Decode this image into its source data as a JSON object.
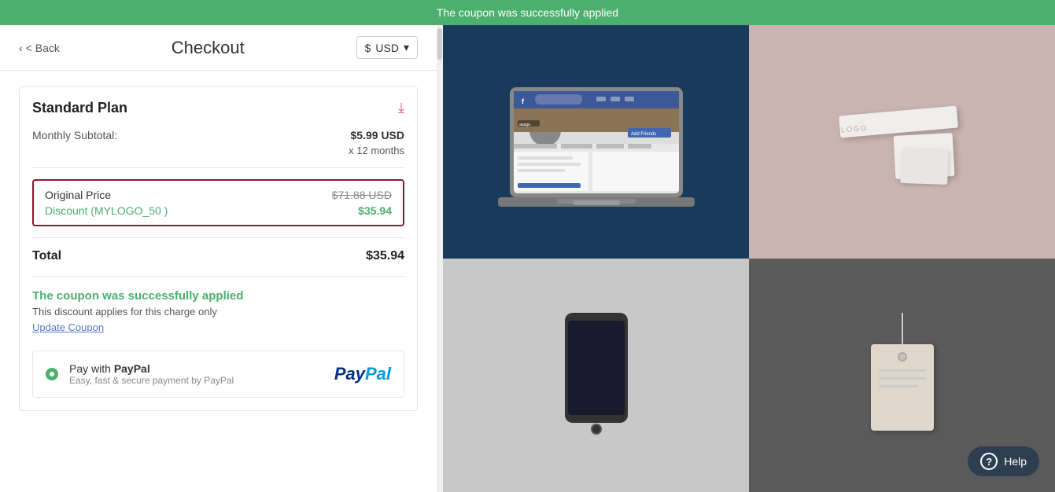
{
  "banner": {
    "message": "The coupon was successfully applied"
  },
  "header": {
    "back_label": "< Back",
    "title": "Checkout",
    "currency_label": "$ USD",
    "currency_arrow": "▾"
  },
  "plan": {
    "name": "Standard Plan",
    "chevron": "❯",
    "monthly_subtotal_label": "Monthly Subtotal:",
    "monthly_subtotal_value": "$5.99 USD",
    "months_label": "x 12 months",
    "original_price_label": "Original Price",
    "original_price_value": "$71.88 USD",
    "discount_label": "Discount (MYLOGO_50 )",
    "discount_value": "$35.94",
    "total_label": "Total",
    "total_value": "$35.94"
  },
  "coupon": {
    "success_title": "The coupon was successfully applied",
    "success_subtitle": "This discount applies for this charge only",
    "update_link": "Update Coupon"
  },
  "payment": {
    "title_prefix": "Pay with ",
    "title_bold": "PayPal",
    "subtitle": "Easy, fast & secure payment by PayPal",
    "logo_blue": "Pay",
    "logo_cyan": "Pal"
  },
  "help": {
    "label": "Help",
    "icon": "?"
  },
  "colors": {
    "green": "#4caf6e",
    "dark_red_border": "#8b1a2a",
    "discount_green": "#4caf6e",
    "banner_green": "#4caf6e"
  }
}
